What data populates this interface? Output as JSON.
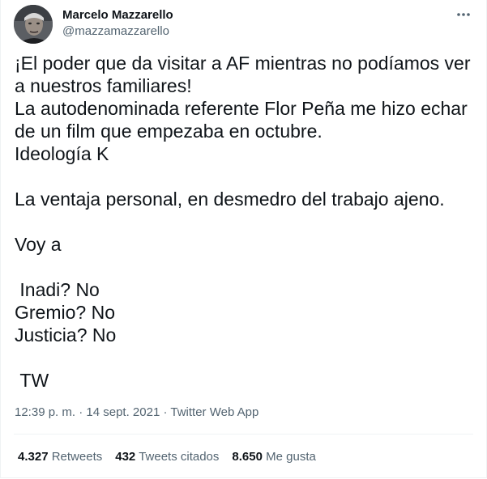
{
  "author": {
    "display_name": "Marcelo Mazzarello",
    "handle": "@mazzamazzarello",
    "avatar_icon": "avatar-photo"
  },
  "more_icon": "more-horizontal-icon",
  "tweet": {
    "text": "¡El poder que da visitar a AF mientras no podíamos ver\na nuestros familiares!\nLa autodenominada referente Flor Peña me hizo echar\nde un film que empezaba en octubre.\nIdeología K\n\nLa ventaja personal, en desmedro del trabajo ajeno.\n\nVoy a\n\n Inadi? No\nGremio? No\nJusticia? No\n\n TW"
  },
  "meta": {
    "time": "12:39 p. m.",
    "separator": " · ",
    "date": "14 sept. 2021",
    "source": "Twitter Web App"
  },
  "stats": {
    "retweets_count": "4.327",
    "retweets_label": "Retweets",
    "quotes_count": "432",
    "quotes_label": "Tweets citados",
    "likes_count": "8.650",
    "likes_label": "Me gusta"
  },
  "colors": {
    "text": "#0f1419",
    "secondary": "#536471",
    "divider": "#eff3f4"
  }
}
